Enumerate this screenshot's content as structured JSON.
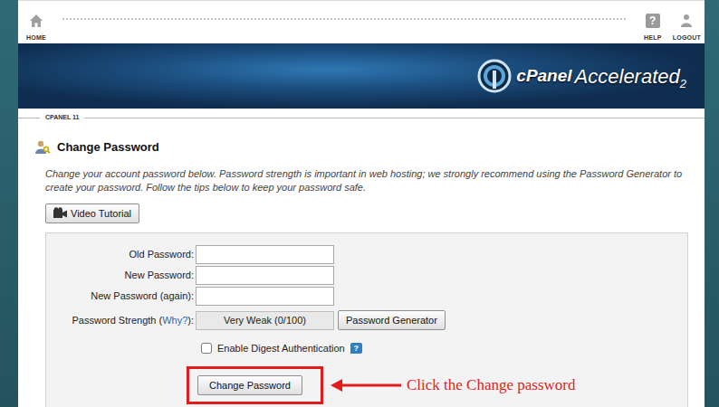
{
  "nav": {
    "home": "HOME",
    "help": "HELP",
    "help_glyph": "?",
    "logout": "LOGOUT"
  },
  "banner": {
    "logo_main": "cPanel",
    "logo_sub": "Accelerated",
    "logo_version": "2"
  },
  "breadcrumb": "CPANEL 11",
  "page": {
    "title": "Change Password",
    "description": "Change your account password below. Password strength is important in web hosting; we strongly recommend using the Password Generator to create your password. Follow the tips below to keep your password safe."
  },
  "video_button": "Video Tutorial",
  "form": {
    "fields": [
      {
        "label": "Old Password:",
        "value": ""
      },
      {
        "label": "New Password:",
        "value": ""
      },
      {
        "label": "New Password (again):",
        "value": ""
      }
    ],
    "strength": {
      "label": "Password Strength (",
      "link": "Why?",
      "suffix": "):",
      "value": "Very Weak (0/100)",
      "level": 0
    },
    "generator": "Password Generator",
    "digest": {
      "label": "Enable Digest Authentication",
      "checked": false,
      "help": "?"
    },
    "submit": "Change Password"
  },
  "annotation": {
    "text": "Click the Change password"
  }
}
